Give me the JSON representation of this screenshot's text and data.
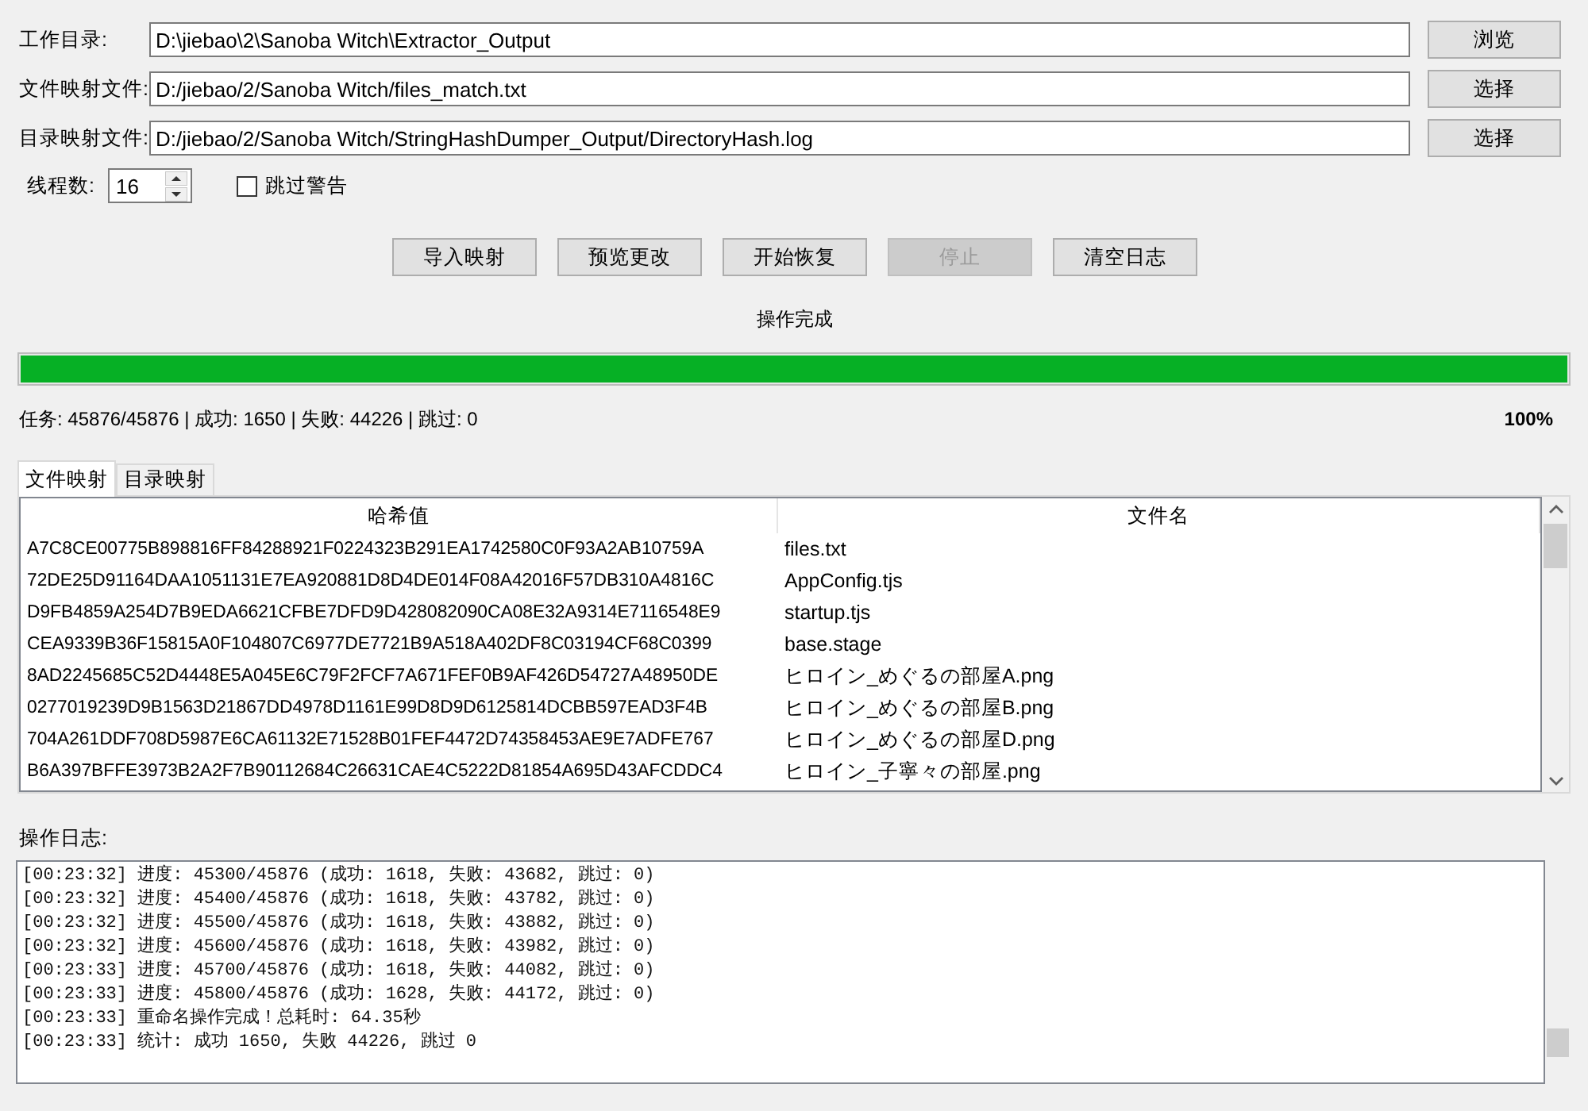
{
  "form": {
    "fields": [
      {
        "label": "工作目录:",
        "value": "D:\\jiebao\\2\\Sanoba Witch\\Extractor_Output",
        "button": "浏览"
      },
      {
        "label": "文件映射文件:",
        "value": "D:/jiebao/2/Sanoba Witch/files_match.txt",
        "button": "选择"
      },
      {
        "label": "目录映射文件:",
        "value": "D:/jiebao/2/Sanoba Witch/StringHashDumper_Output/DirectoryHash.log",
        "button": "选择"
      }
    ],
    "threads": {
      "label": "线程数:",
      "value": "16"
    },
    "skip_warnings": {
      "label": "跳过警告",
      "checked": false
    }
  },
  "actions": [
    {
      "label": "导入映射",
      "disabled": false
    },
    {
      "label": "预览更改",
      "disabled": false
    },
    {
      "label": "开始恢复",
      "disabled": false
    },
    {
      "label": "停止",
      "disabled": true
    },
    {
      "label": "清空日志",
      "disabled": false
    }
  ],
  "status": "操作完成",
  "progress": {
    "level": 1.0,
    "summary": "任务: 45876/45876 | 成功: 1650 | 失败: 44226 | 跳过: 0",
    "percent": "100%"
  },
  "tabs": [
    {
      "label": "文件映射",
      "selected": true
    },
    {
      "label": "目录映射",
      "selected": false
    }
  ],
  "table": {
    "columns": [
      "哈希值",
      "文件名"
    ],
    "rows": [
      {
        "hash": "A7C8CE00775B898816FF84288921F0224323B291EA1742580C0F93A2AB10759A",
        "file_name": "files.txt"
      },
      {
        "hash": "72DE25D91164DAA1051131E7EA920881D8D4DE014F08A42016F57DB310A4816C",
        "file_name": "AppConfig.tjs"
      },
      {
        "hash": "D9FB4859A254D7B9EDA6621CFBE7DFD9D428082090CA08E32A9314E7116548E9",
        "file_name": "startup.tjs"
      },
      {
        "hash": "CEA9339B36F15815A0F104807C6977DE7721B9A518A402DF8C03194CF68C0399",
        "file_name": "base.stage"
      },
      {
        "hash": "8AD2245685C52D4448E5A045E6C79F2FCF7A671FEF0B9AF426D54727A48950DE",
        "file_name": "ヒロイン_めぐるの部屋A.png"
      },
      {
        "hash": "0277019239D9B1563D21867DD4978D1161E99D8D9D6125814DCBB597EAD3F4B",
        "file_name": "ヒロイン_めぐるの部屋B.png"
      },
      {
        "hash": "704A261DDF708D5987E6CA61132E71528B01FEF4472D74358453AE9E7ADFE767",
        "file_name": "ヒロイン_めぐるの部屋D.png"
      },
      {
        "hash": "B6A397BFFE3973B2A2F7B90112684C26631CAE4C5222D81854A695D43AFCDDC4",
        "file_name": "ヒロイン_子寧々の部屋.png"
      }
    ]
  },
  "log": {
    "label": "操作日志:",
    "lines": [
      "[00:23:32] 进度: 45300/45876 (成功: 1618, 失败: 43682, 跳过: 0)",
      "[00:23:32] 进度: 45400/45876 (成功: 1618, 失败: 43782, 跳过: 0)",
      "[00:23:32] 进度: 45500/45876 (成功: 1618, 失败: 43882, 跳过: 0)",
      "[00:23:32] 进度: 45600/45876 (成功: 1618, 失败: 43982, 跳过: 0)",
      "[00:23:33] 进度: 45700/45876 (成功: 1618, 失败: 44082, 跳过: 0)",
      "[00:23:33] 进度: 45800/45876 (成功: 1628, 失败: 44172, 跳过: 0)",
      "[00:23:33] 重命名操作完成！总耗时: 64.35秒",
      "[00:23:33] 统计: 成功 1650, 失败 44226, 跳过 0"
    ]
  }
}
